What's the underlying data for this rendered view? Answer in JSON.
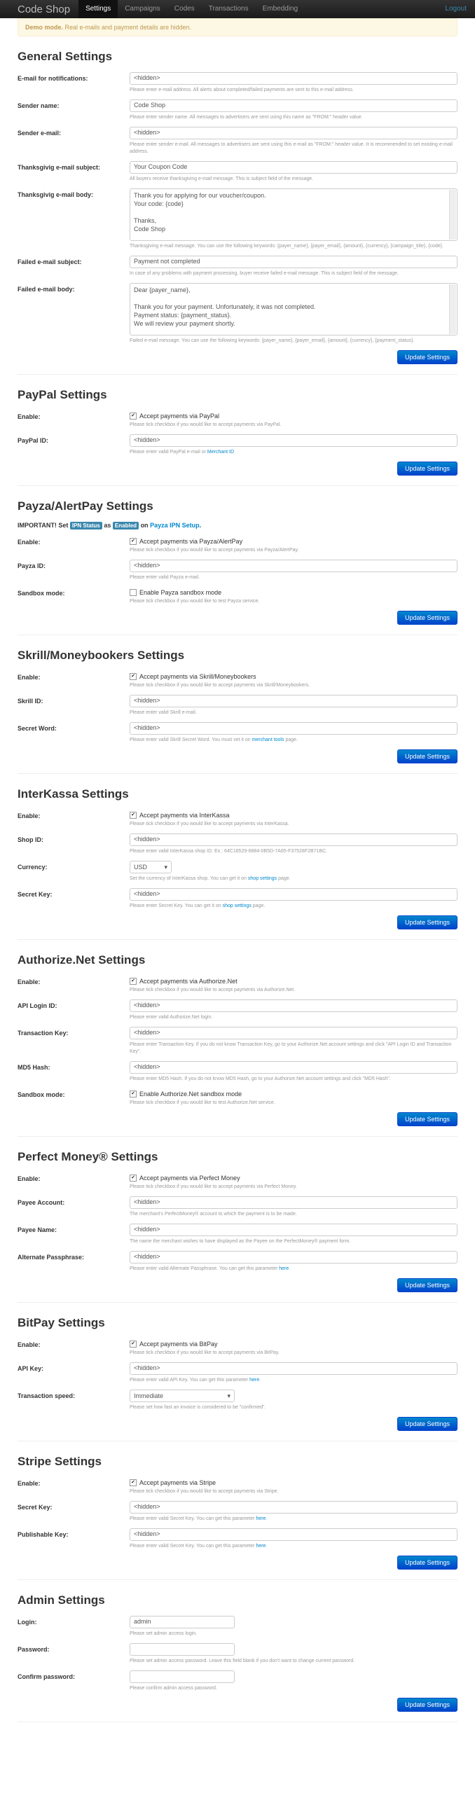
{
  "nav": {
    "brand": "Code Shop",
    "items": [
      "Settings",
      "Campaigns",
      "Codes",
      "Transactions",
      "Embedding"
    ],
    "logout": "Logout"
  },
  "alert": {
    "strong": "Demo mode.",
    "text": "Real e-mails and payment details are hidden."
  },
  "update": "Update Settings",
  "general": {
    "title": "General Settings",
    "email_label": "E-mail for notifications:",
    "email_value": "<hidden>",
    "email_help": "Please enter e-mail address. All alerts about completed/failed payments are sent to this e-mail address.",
    "sender_label": "Sender name:",
    "sender_value": "Code Shop",
    "sender_help": "Please enter sender name. All messages to advertisers are sent using this name as \"FROM:\" header value.",
    "sender_email_label": "Sender e-mail:",
    "sender_email_value": "<hidden>",
    "sender_email_help": "Please enter sender e-mail. All messages to advertisers are sent using this e-mail as \"FROM:\" header value. It is recommended to set existing e-mail address.",
    "thx_subj_label": "Thanksgivig e-mail subject:",
    "thx_subj_value": "Your Coupon Code",
    "thx_subj_help": "All buyers receive thanksgiving e-mail message. This is subject field of the message.",
    "thx_body_label": "Thanksgivig e-mail body:",
    "thx_body_value": "Thank you for applying for our voucher/coupon.\nYour code: {code}\n\nThanks,\nCode Shop",
    "thx_body_help": "Thanksgiving e-mail message. You can use the following keywords: {payer_name}, {payer_email}, {amount}, {currency}, {campaign_title}, {code}.",
    "fail_subj_label": "Failed e-mail subject:",
    "fail_subj_value": "Payment not completed",
    "fail_subj_help": "In case of any problems with payment processing, buyer receive failed e-mail message. This is subject field of the message.",
    "fail_body_label": "Failed e-mail body:",
    "fail_body_value": "Dear {payer_name},\n\nThank you for your payment. Unfortunately, it was not completed.\nPayment status: {payment_status}.\nWe will review your payment shortly.",
    "fail_body_help": "Failed e-mail message. You can use the following keywords: {payer_name}, {payer_email}, {amount}, {currency}, {payment_status}."
  },
  "paypal": {
    "title": "PayPal Settings",
    "enable_label": "Enable:",
    "enable_text": "Accept payments via PayPal",
    "enable_help": "Please tick checkbox if you would like to accept payments via PayPal.",
    "id_label": "PayPal ID:",
    "id_value": "<hidden>",
    "id_help": "Please enter valid PayPal e-mail or",
    "id_link": "Merchant ID"
  },
  "payza": {
    "title": "Payza/AlertPay Settings",
    "imp1": "IMPORTANT! Set",
    "imp_lbl1": "IPN Status",
    "imp2": "as",
    "imp_lbl2": "Enabled",
    "imp3": "on",
    "imp_link": "Payza IPN Setup",
    "enable_label": "Enable:",
    "enable_text": "Accept payments via Payza/AlertPay",
    "enable_help": "Please tick checkbox if you would like to accept payments via Payza/AlertPay.",
    "id_label": "Payza ID:",
    "id_value": "<hidden>",
    "id_help": "Please enter valid Payza e-mail.",
    "sandbox_label": "Sandbox mode:",
    "sandbox_text": "Enable Payza sandbox mode",
    "sandbox_help": "Please tick checkbox if you would like to test Payza service."
  },
  "skrill": {
    "title": "Skrill/Moneybookers Settings",
    "enable_label": "Enable:",
    "enable_text": "Accept payments via Skrill/Moneybookers",
    "enable_help": "Please tick checkbox if you would like to accept payments via Skrill/Moneybookers.",
    "id_label": "Skrill ID:",
    "id_value": "<hidden>",
    "id_help": "Please enter valid Skrill e-mail.",
    "secret_label": "Secret Word:",
    "secret_value": "<hidden>",
    "secret_help": "Please enter valid Skrill Secret Word. You must set it on",
    "secret_link": "merchant tools",
    "secret_help2": "page."
  },
  "interkassa": {
    "title": "InterKassa Settings",
    "enable_label": "Enable:",
    "enable_text": "Accept payments via InterKassa",
    "enable_help": "Please tick checkbox if you would like to accept payments via InterKassa.",
    "shop_label": "Shop ID:",
    "shop_value": "<hidden>",
    "shop_help": "Please enter valid InterKassa shop ID. Ex.: 64C18529-6884-0B5D-7A65-F37528F2B71BC.",
    "cur_label": "Currency:",
    "cur_value": "USD",
    "cur_help": "Set the currency of InterKassa shop. You can get it on",
    "cur_link": "shop settings",
    "cur_help2": "page.",
    "key_label": "Secret Key:",
    "key_value": "<hidden>",
    "key_help": "Please enter Secret Key. You can get it on",
    "key_link": "shop settings",
    "key_help2": "page."
  },
  "authorize": {
    "title": "Authorize.Net Settings",
    "enable_label": "Enable:",
    "enable_text": "Accept payments via Authorize.Net",
    "enable_help": "Please tick checkbox if you would like to accept payments via Authorize.Net.",
    "login_label": "API Login ID:",
    "login_value": "<hidden>",
    "login_help": "Please enter valid Authorize.Net login.",
    "tkey_label": "Transaction Key:",
    "tkey_value": "<hidden>",
    "tkey_help": "Please enter Transaction Key. If you do not know Transaction Key, go to your Authorize.Net account settings and click \"API Login ID and Transaction Key\".",
    "md5_label": "MD5 Hash:",
    "md5_value": "<hidden>",
    "md5_help": "Please enter MD5 Hash. If you do not know MD5 Hash, go to your Authorize.Net account settings and click \"MD5 Hash\".",
    "sandbox_label": "Sandbox mode:",
    "sandbox_text": "Enable Authorize.Net sandbox mode",
    "sandbox_help": "Please tick checkbox if you would like to test Authorize.Net service."
  },
  "pm": {
    "title": "Perfect Money® Settings",
    "enable_label": "Enable:",
    "enable_text": "Accept payments via Perfect Money",
    "enable_help": "Please tick checkbox if you would like to accept payments via Perfect Money.",
    "acc_label": "Payee Account:",
    "acc_value": "<hidden>",
    "acc_help": "The merchant's PerfectMoney® account to which the payment is to be made.",
    "name_label": "Payee Name:",
    "name_value": "<hidden>",
    "name_help": "The name the merchant wishes to have displayed as the Payee on the PerfectMoney® payment form.",
    "pass_label": "Alternate Passphrase:",
    "pass_value": "<hidden>",
    "pass_help": "Please enter valid Alternate Passphrase. You can get this parameter",
    "pass_link": "here"
  },
  "bitpay": {
    "title": "BitPay Settings",
    "enable_label": "Enable:",
    "enable_text": "Accept payments via BitPay",
    "enable_help": "Please tick checkbox if you would like to accept payments via BitPay.",
    "key_label": "API Key:",
    "key_value": "<hidden>",
    "key_help": "Please enter valid API Key. You can get this parameter",
    "key_link": "here",
    "speed_label": "Transaction speed:",
    "speed_value": "Immediate",
    "speed_help": "Please set how fast an invoice is considered to be \"confirmed\"."
  },
  "stripe": {
    "title": "Stripe Settings",
    "enable_label": "Enable:",
    "enable_text": "Accept payments via Stripe",
    "enable_help": "Please tick checkbox if you would like to accept payments via Stripe.",
    "secret_label": "Secret Key:",
    "secret_value": "<hidden>",
    "secret_help": "Please enter valid Secret Key. You can get this parameter",
    "secret_link": "here",
    "pub_label": "Publishable Key:",
    "pub_value": "<hidden>",
    "pub_help": "Please enter valid Secret Key. You can get this parameter",
    "pub_link": "here"
  },
  "admin": {
    "title": "Admin Settings",
    "login_label": "Login:",
    "login_value": "admin",
    "login_help": "Please set admin access login.",
    "pass_label": "Password:",
    "pass_value": "",
    "pass_help": "Please set admin access password. Leave this field blank if you don't want to change current password.",
    "confirm_label": "Confirm password:",
    "confirm_value": "",
    "confirm_help": "Please confirm admin access password."
  }
}
